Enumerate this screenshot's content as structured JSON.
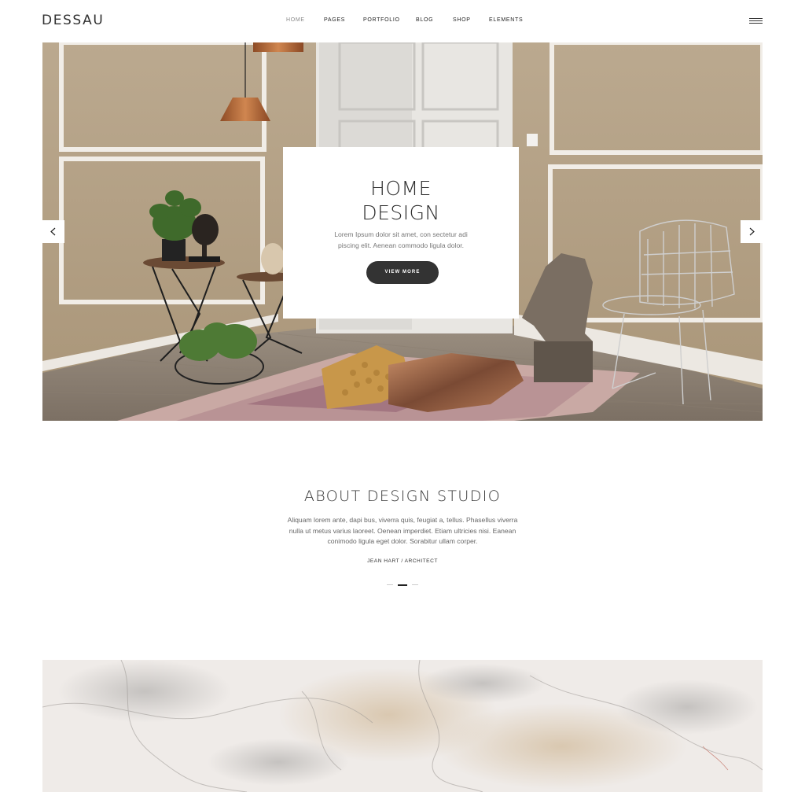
{
  "header": {
    "logo": "DESSAU",
    "nav": [
      {
        "label": "HOME",
        "active": true
      },
      {
        "label": "PAGES",
        "active": false
      },
      {
        "label": "PORTFOLIO",
        "active": false
      },
      {
        "label": "BLOG",
        "active": false
      },
      {
        "label": "SHOP",
        "active": false
      },
      {
        "label": "ELEMENTS",
        "active": false
      }
    ],
    "menu_icon": "hamburger-icon"
  },
  "hero": {
    "title": "HOME\nDESIGN",
    "description": "Lorem Ipsum dolor sit amet, con sectetur adi piscing elit. Aenean commodo ligula dolor.",
    "button_label": "VIEW MORE",
    "prev_icon": "chevron-left-icon",
    "next_icon": "chevron-right-icon"
  },
  "about": {
    "title": "ABOUT DESIGN STUDIO",
    "text": "Aliquam lorem ante, dapi bus, viverra quis, feugiat a, tellus. Phasellus viverra nulla ut metus varius laoreet. Oenean imperdiet. Etiam ultricies nisi. Eanean conimodo ligula eget dolor. Sorabitur ullam corper.",
    "author": "JEAN HART  /  ARCHITECT",
    "slides_total": 3,
    "active_slide": 2
  },
  "colors": {
    "wall": "#b8a68c",
    "dark_button": "#333333",
    "text": "#222222"
  }
}
